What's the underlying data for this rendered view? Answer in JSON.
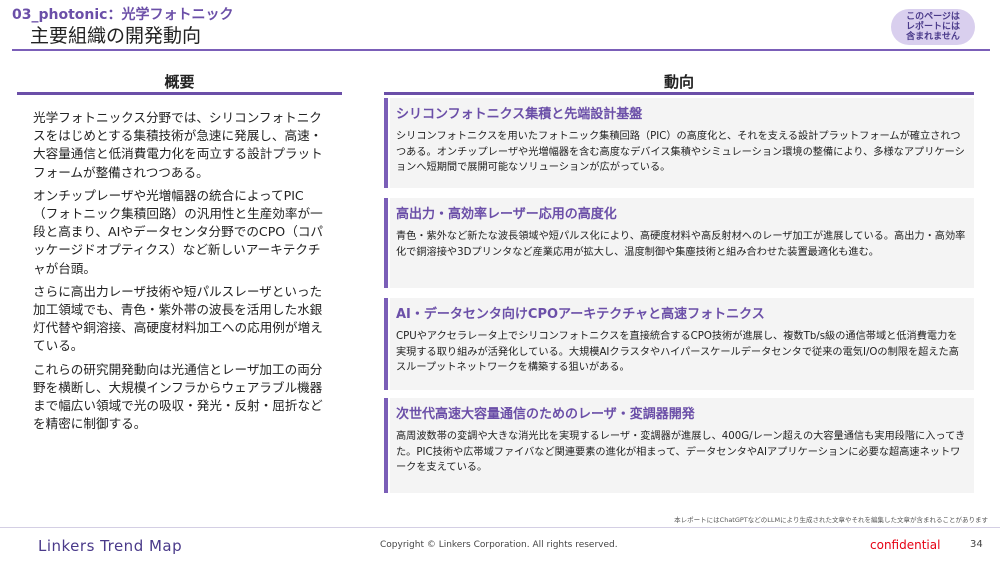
{
  "header": {
    "subtitle": "03_photonic：光学フォトニック",
    "title": "主要組織の開発動向",
    "notice": "このページは\nレポートには\n含まれません"
  },
  "columns": {
    "left_heading": "概要",
    "right_heading": "動向"
  },
  "overview": [
    "光学フォトニックス分野では、シリコンフォトニクスをはじめとする集積技術が急速に発展し、高速・大容量通信と低消費電力化を両立する設計プラットフォームが整備されつつある。",
    "オンチップレーザや光増幅器の統合によってPIC（フォトニック集積回路）の汎用性と生産効率が一段と高まり、AIやデータセンタ分野でのCPO（コパッケージドオプティクス）など新しいアーキテクチャが台頭。",
    "さらに高出力レーザ技術や短パルスレーザといった加工領域でも、青色・紫外帯の波長を活用した水銀灯代替や銅溶接、高硬度材料加工への応用例が増えている。",
    "これらの研究開発動向は光通信とレーザ加工の両分野を横断し、大規模インフラからウェアラブル機器まで幅広い領域で光の吸収・発光・反射・屈折などを精密に制御する。"
  ],
  "trends": [
    {
      "title": "シリコンフォトニクス集積と先端設計基盤",
      "body": "シリコンフォトニクスを用いたフォトニック集積回路（PIC）の高度化と、それを支える設計プラットフォームが確立されつつある。オンチップレーザや光増幅器を含む高度なデバイス集積やシミュレーション環境の整備により、多様なアプリケーションへ短期間で展開可能なソリューションが広がっている。"
    },
    {
      "title": "高出力・高効率レーザー応用の高度化",
      "body": "青色・紫外など新たな波長領域や短パルス化により、高硬度材料や高反射材へのレーザ加工が進展している。高出力・高効率化で銅溶接や3Dプリンタなど産業応用が拡大し、温度制御や集塵技術と組み合わせた装置最適化も進む。"
    },
    {
      "title": "AI・データセンタ向けCPOアーキテクチャと高速フォトニクス",
      "body": "CPUやアクセラレータ上でシリコンフォトニクスを直接統合するCPO技術が進展し、複数Tb/s級の通信帯域と低消費電力を実現する取り組みが活発化している。大規模AIクラスタやハイパースケールデータセンタで従来の電気I/Oの制限を超えた高スループットネットワークを構築する狙いがある。"
    },
    {
      "title": "次世代高速大容量通信のためのレーザ・変調器開発",
      "body": "高周波数帯の変調や大きな消光比を実現するレーザ・変調器が進展し、400G/レーン超えの大容量通信も実用段階に入ってきた。PIC技術や広帯域ファイバなど関連要素の進化が相まって、データセンタやAIアプリケーションに必要な超高速ネットワークを支えている。"
    }
  ],
  "footer": {
    "disclaimer": "本レポートにはChatGPTなどのLLMにより生成された文章やそれを編集した文章が含まれることがあります",
    "brand": "Linkers Trend Map",
    "copyright": "Copyright © Linkers Corporation. All rights reserved.",
    "confidential": "confidential",
    "page": "34"
  }
}
